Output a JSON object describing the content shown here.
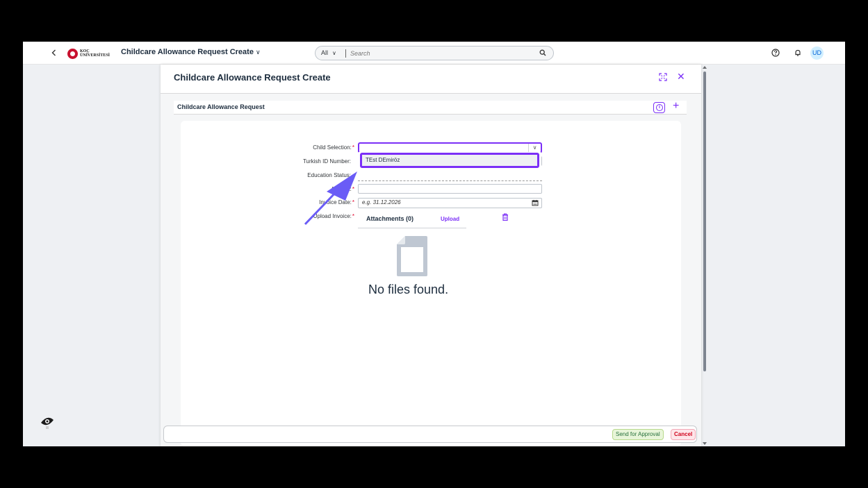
{
  "shell": {
    "back_icon": "chevron-left-icon",
    "logo_text_1": "KOÇ",
    "logo_text_2": "ÜNİVERSİTESİ",
    "app_title": "Childcare Allowance Request Create",
    "search": {
      "scope": "All",
      "placeholder": "Search"
    },
    "avatar_initials": "UD"
  },
  "dialog": {
    "title": "Childcare Allowance Request Create",
    "section_title": "Childcare Allowance Request",
    "info_icon_glyph": "i",
    "form": {
      "child_selection_label": "Child Selection:",
      "turkish_id_label": "Turkish ID Number:",
      "education_status_label": "Education Status:",
      "amount_label": "Amount:",
      "invoice_date_label": "Invoice Date:",
      "upload_invoice_label": "Upload Invoice:",
      "required_mark": "*",
      "child_selection_value": "",
      "dropdown_options": [
        "TEst DEmiröz"
      ],
      "invoice_date_placeholder": "e.g. 31.12.2026"
    },
    "attachments": {
      "title": "Attachments (0)",
      "upload_label": "Upload",
      "empty_text": "No files found."
    },
    "footer": {
      "send_label": "Send for Approval",
      "cancel_label": "Cancel"
    }
  },
  "colors": {
    "accent": "#7b2ff7",
    "required": "#e0002a",
    "send_bg": "#e8f5d9",
    "cancel_bg": "#fde6ea"
  }
}
